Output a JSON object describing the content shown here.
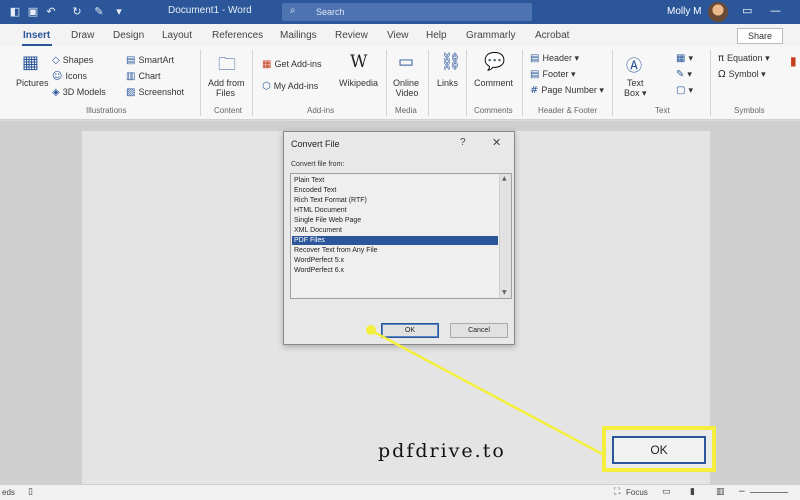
{
  "titlebar": {
    "document_title": "Document1  -  Word",
    "search_placeholder": "Search",
    "user_name": "Molly M",
    "icons": [
      "save-icon",
      "undo-icon",
      "redo-icon",
      "customize-icon"
    ]
  },
  "tabs": [
    "Insert",
    "Draw",
    "Design",
    "Layout",
    "References",
    "Mailings",
    "Review",
    "View",
    "Help",
    "Grammarly",
    "Acrobat"
  ],
  "active_tab": "Insert",
  "share_label": "Share",
  "ribbon": {
    "pictures": "Pictures",
    "shapes": "Shapes",
    "icons": "Icons",
    "models_3d": "3D Models",
    "smartart": "SmartArt",
    "chart": "Chart",
    "screenshot": "Screenshot",
    "illustrations_group": "Illustrations",
    "add_from": "Add from",
    "files": "Files",
    "content_group": "Content",
    "get_addins": "Get Add-ins",
    "my_addins": "My Add-ins",
    "wikipedia": "Wikipedia",
    "addins_group": "Add-ins",
    "online": "Online",
    "video": "Video",
    "media_group": "Media",
    "links": "Links",
    "comment": "Comment",
    "comments_group": "Comments",
    "header": "Header",
    "footer": "Footer",
    "page_number": "Page Number",
    "header_footer_group": "Header & Footer",
    "text": "Text",
    "box": "Box",
    "text_group": "Text",
    "equation": "Equation",
    "symbol": "Symbol",
    "symbols_group": "Symbols"
  },
  "dialog": {
    "title": "Convert File",
    "help": "?",
    "label": "Convert file from:",
    "items": [
      "Plain Text",
      "Encoded Text",
      "Rich Text Format (RTF)",
      "HTML Document",
      "Single File Web Page",
      "XML Document",
      "PDF Files",
      "Recover Text from Any File",
      "WordPerfect 5.x",
      "WordPerfect 6.x"
    ],
    "selected_index": 6,
    "ok_label": "OK",
    "cancel_label": "Cancel"
  },
  "callout": {
    "ok_label": "OK",
    "highlight_color": "#f4ee3c"
  },
  "watermark": "pdfdrive.to",
  "statusbar": {
    "left_text": "eds",
    "focus_label": "Focus"
  },
  "colors": {
    "accent": "#2b579a",
    "selection": "#2b579a"
  }
}
